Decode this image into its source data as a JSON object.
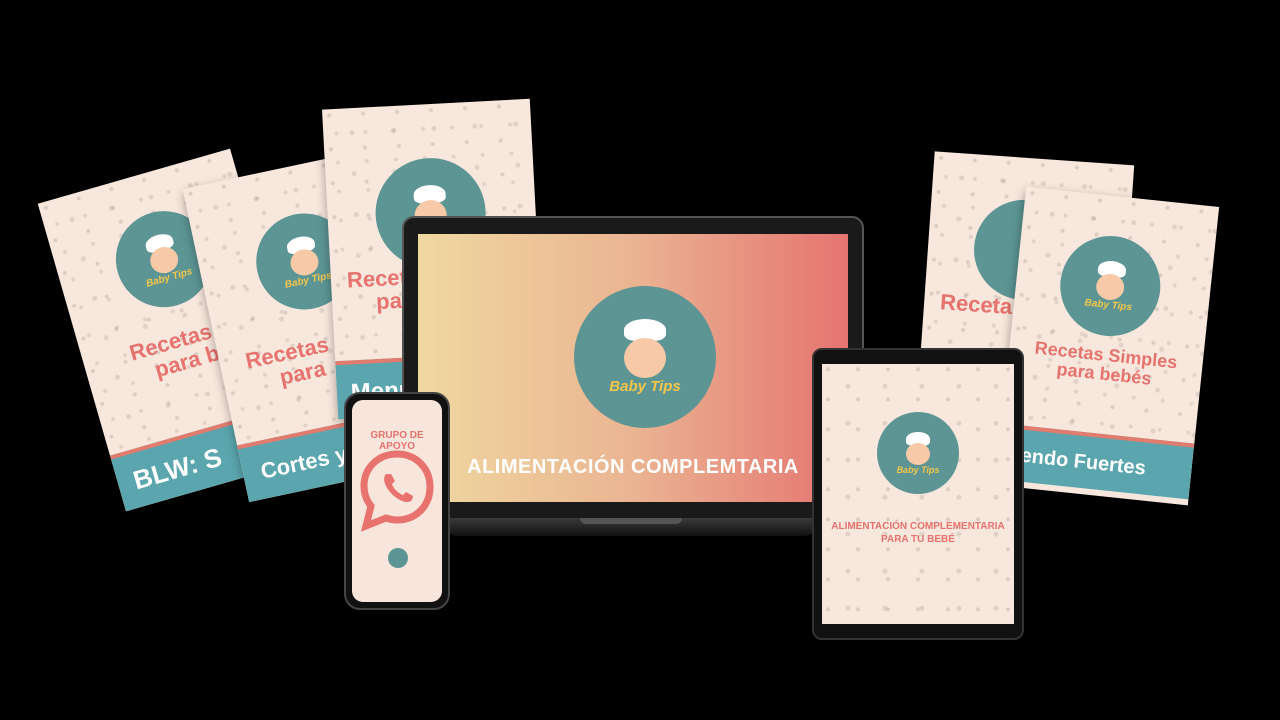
{
  "brand": "Baby Tips",
  "books": {
    "b1": {
      "title_l1": "Recetas S",
      "title_l2": "para b",
      "band": "BLW: S"
    },
    "b2": {
      "title_l1": "Recetas",
      "title_l2": "para",
      "band": "Cortes y"
    },
    "b3": {
      "title_l1": "Receta",
      "title_l2": "par",
      "band": "Menú"
    },
    "b4": {
      "title_l1": "Receta"
    },
    "b5": {
      "title_l1": "Recetas Simples",
      "title_l2": "para bebés",
      "band": "ciendo Fuertes"
    }
  },
  "laptop": {
    "title": "ALIMENTACIÓN COMPLEMTARIA"
  },
  "phone": {
    "title": "GRUPO DE APOYO"
  },
  "tablet": {
    "title_l1": "ALIMENTACIÓN COMPLEMENTARIA",
    "title_l2": "PARA TU BEBÉ"
  },
  "colors": {
    "cover": "#f7e7dc",
    "teal": "#5c9594",
    "band": "#5ba6ae",
    "coral": "#e8726e",
    "gold": "#f3c64a"
  }
}
